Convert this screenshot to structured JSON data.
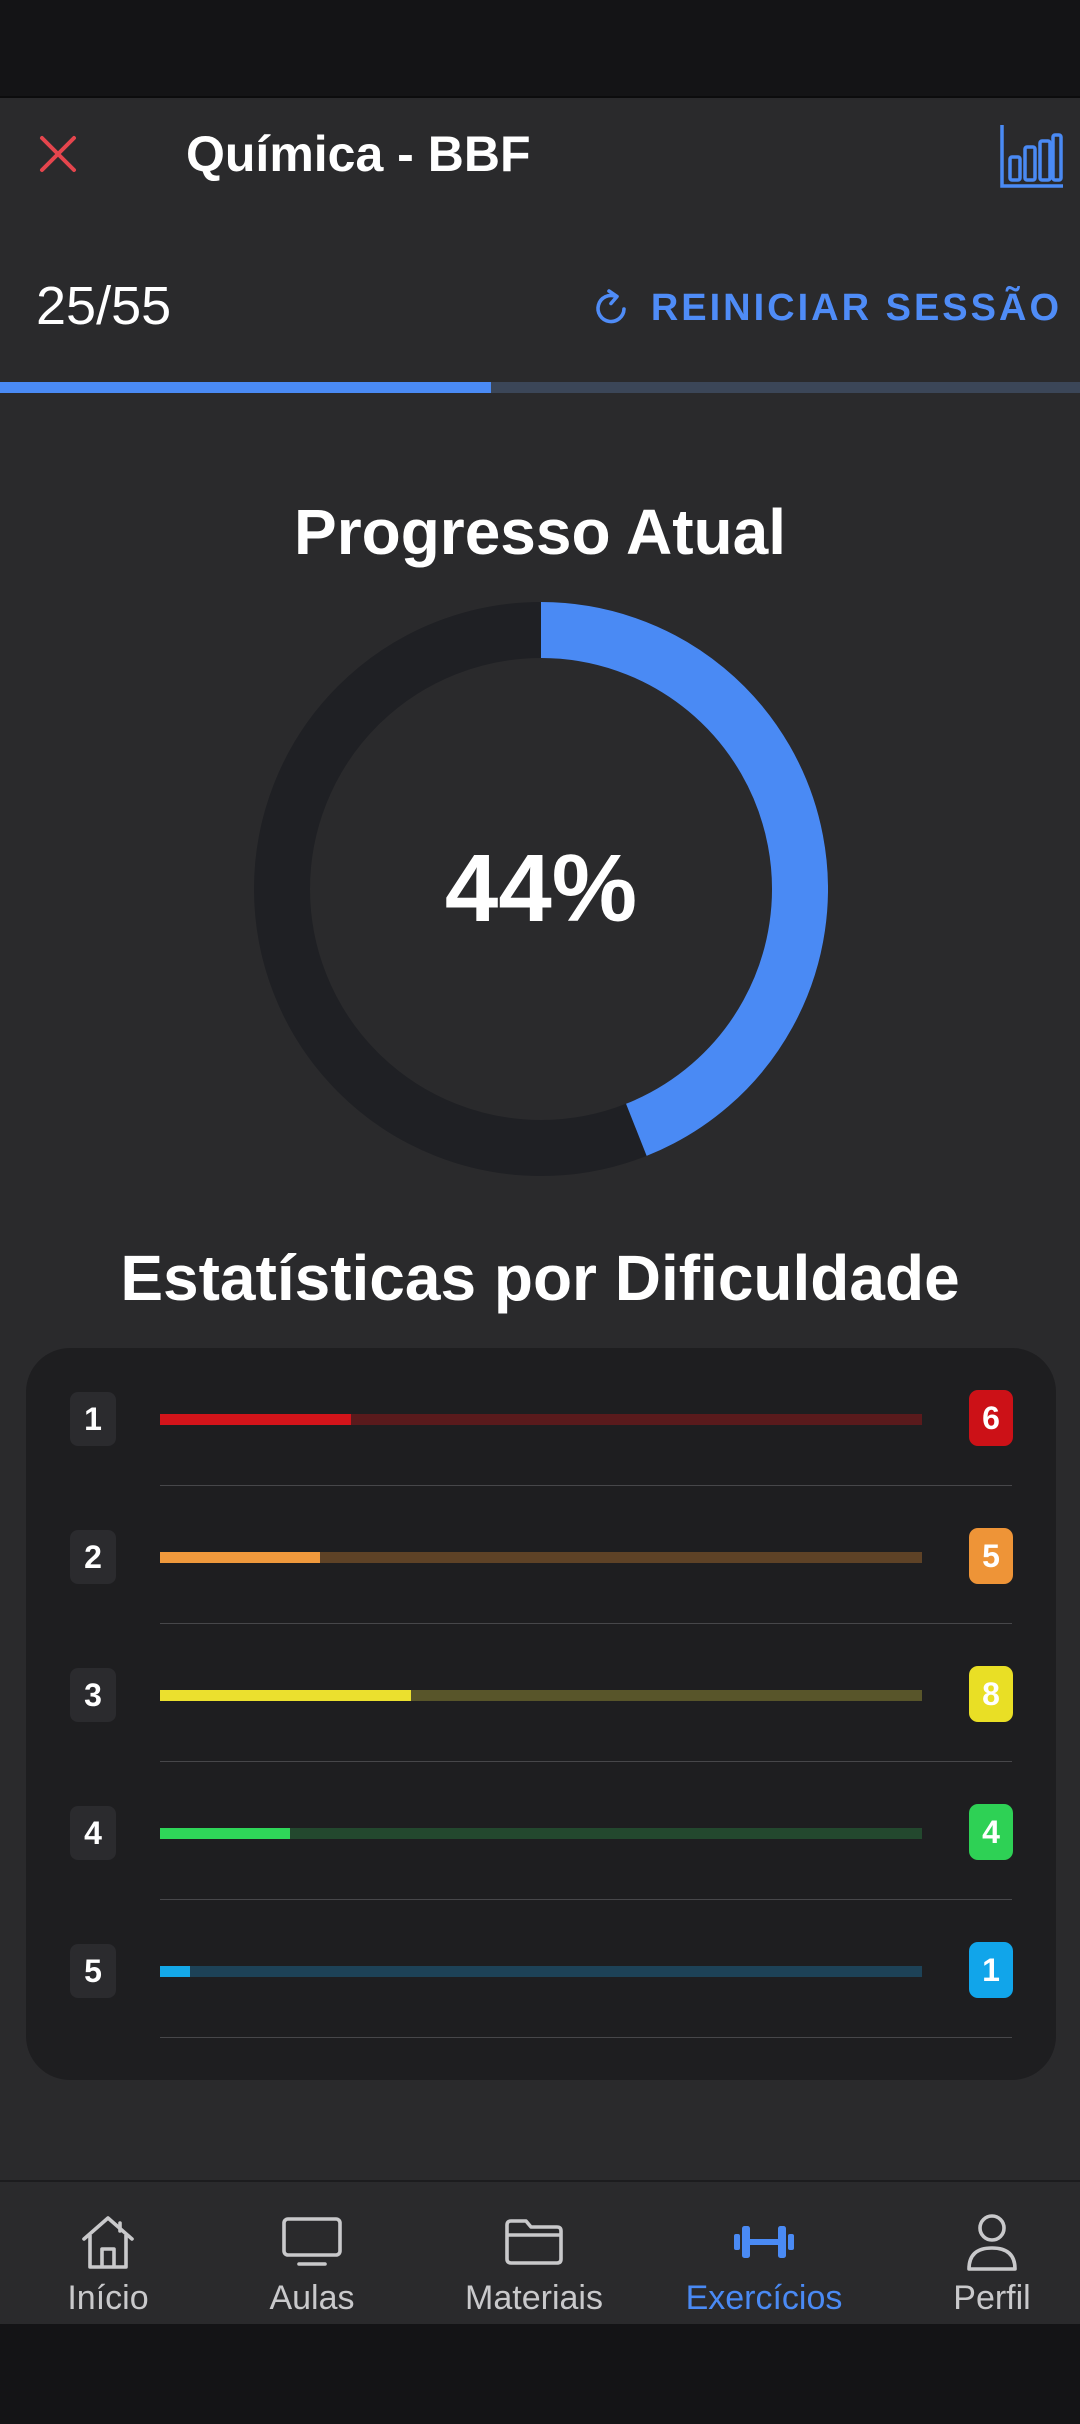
{
  "header": {
    "title": "Química - BBF"
  },
  "session": {
    "counter": "25/55",
    "restart_label": "REINICIAR SESSÃO",
    "answered": 25,
    "total": 55
  },
  "progress": {
    "title": "Progresso Atual",
    "value_label": "44%",
    "percent": 44
  },
  "stats": {
    "title": "Estatísticas por Dificuldade",
    "rows": [
      {
        "level": "1",
        "count": "6",
        "fill_fraction": 0.25,
        "color": "#d3141a",
        "track_color": "#5a1a1c",
        "badge_color": "#cc1117"
      },
      {
        "level": "2",
        "count": "5",
        "fill_fraction": 0.21,
        "color": "#f0993c",
        "track_color": "#5e4226",
        "badge_color": "#ee9437"
      },
      {
        "level": "3",
        "count": "8",
        "fill_fraction": 0.33,
        "color": "#ebe02e",
        "track_color": "#58552a",
        "badge_color": "#e9df25"
      },
      {
        "level": "4",
        "count": "4",
        "fill_fraction": 0.17,
        "color": "#2fd659",
        "track_color": "#23482e",
        "badge_color": "#2ed155"
      },
      {
        "level": "5",
        "count": "1",
        "fill_fraction": 0.04,
        "color": "#14a8e8",
        "track_color": "#1d4257",
        "badge_color": "#11a5ea"
      }
    ]
  },
  "nav": {
    "items": [
      {
        "label": "Início",
        "icon": "home-icon",
        "active": false
      },
      {
        "label": "Aulas",
        "icon": "monitor-icon",
        "active": false
      },
      {
        "label": "Materiais",
        "icon": "folder-icon",
        "active": false
      },
      {
        "label": "Exercícios",
        "icon": "dumbbell-icon",
        "active": true
      },
      {
        "label": "Perfil",
        "icon": "person-icon",
        "active": false
      }
    ]
  },
  "colors": {
    "accent": "#4a8af4",
    "close": "#e5454d",
    "nav_inactive": "#c9c9cb",
    "ring_track": "#1f2024"
  }
}
